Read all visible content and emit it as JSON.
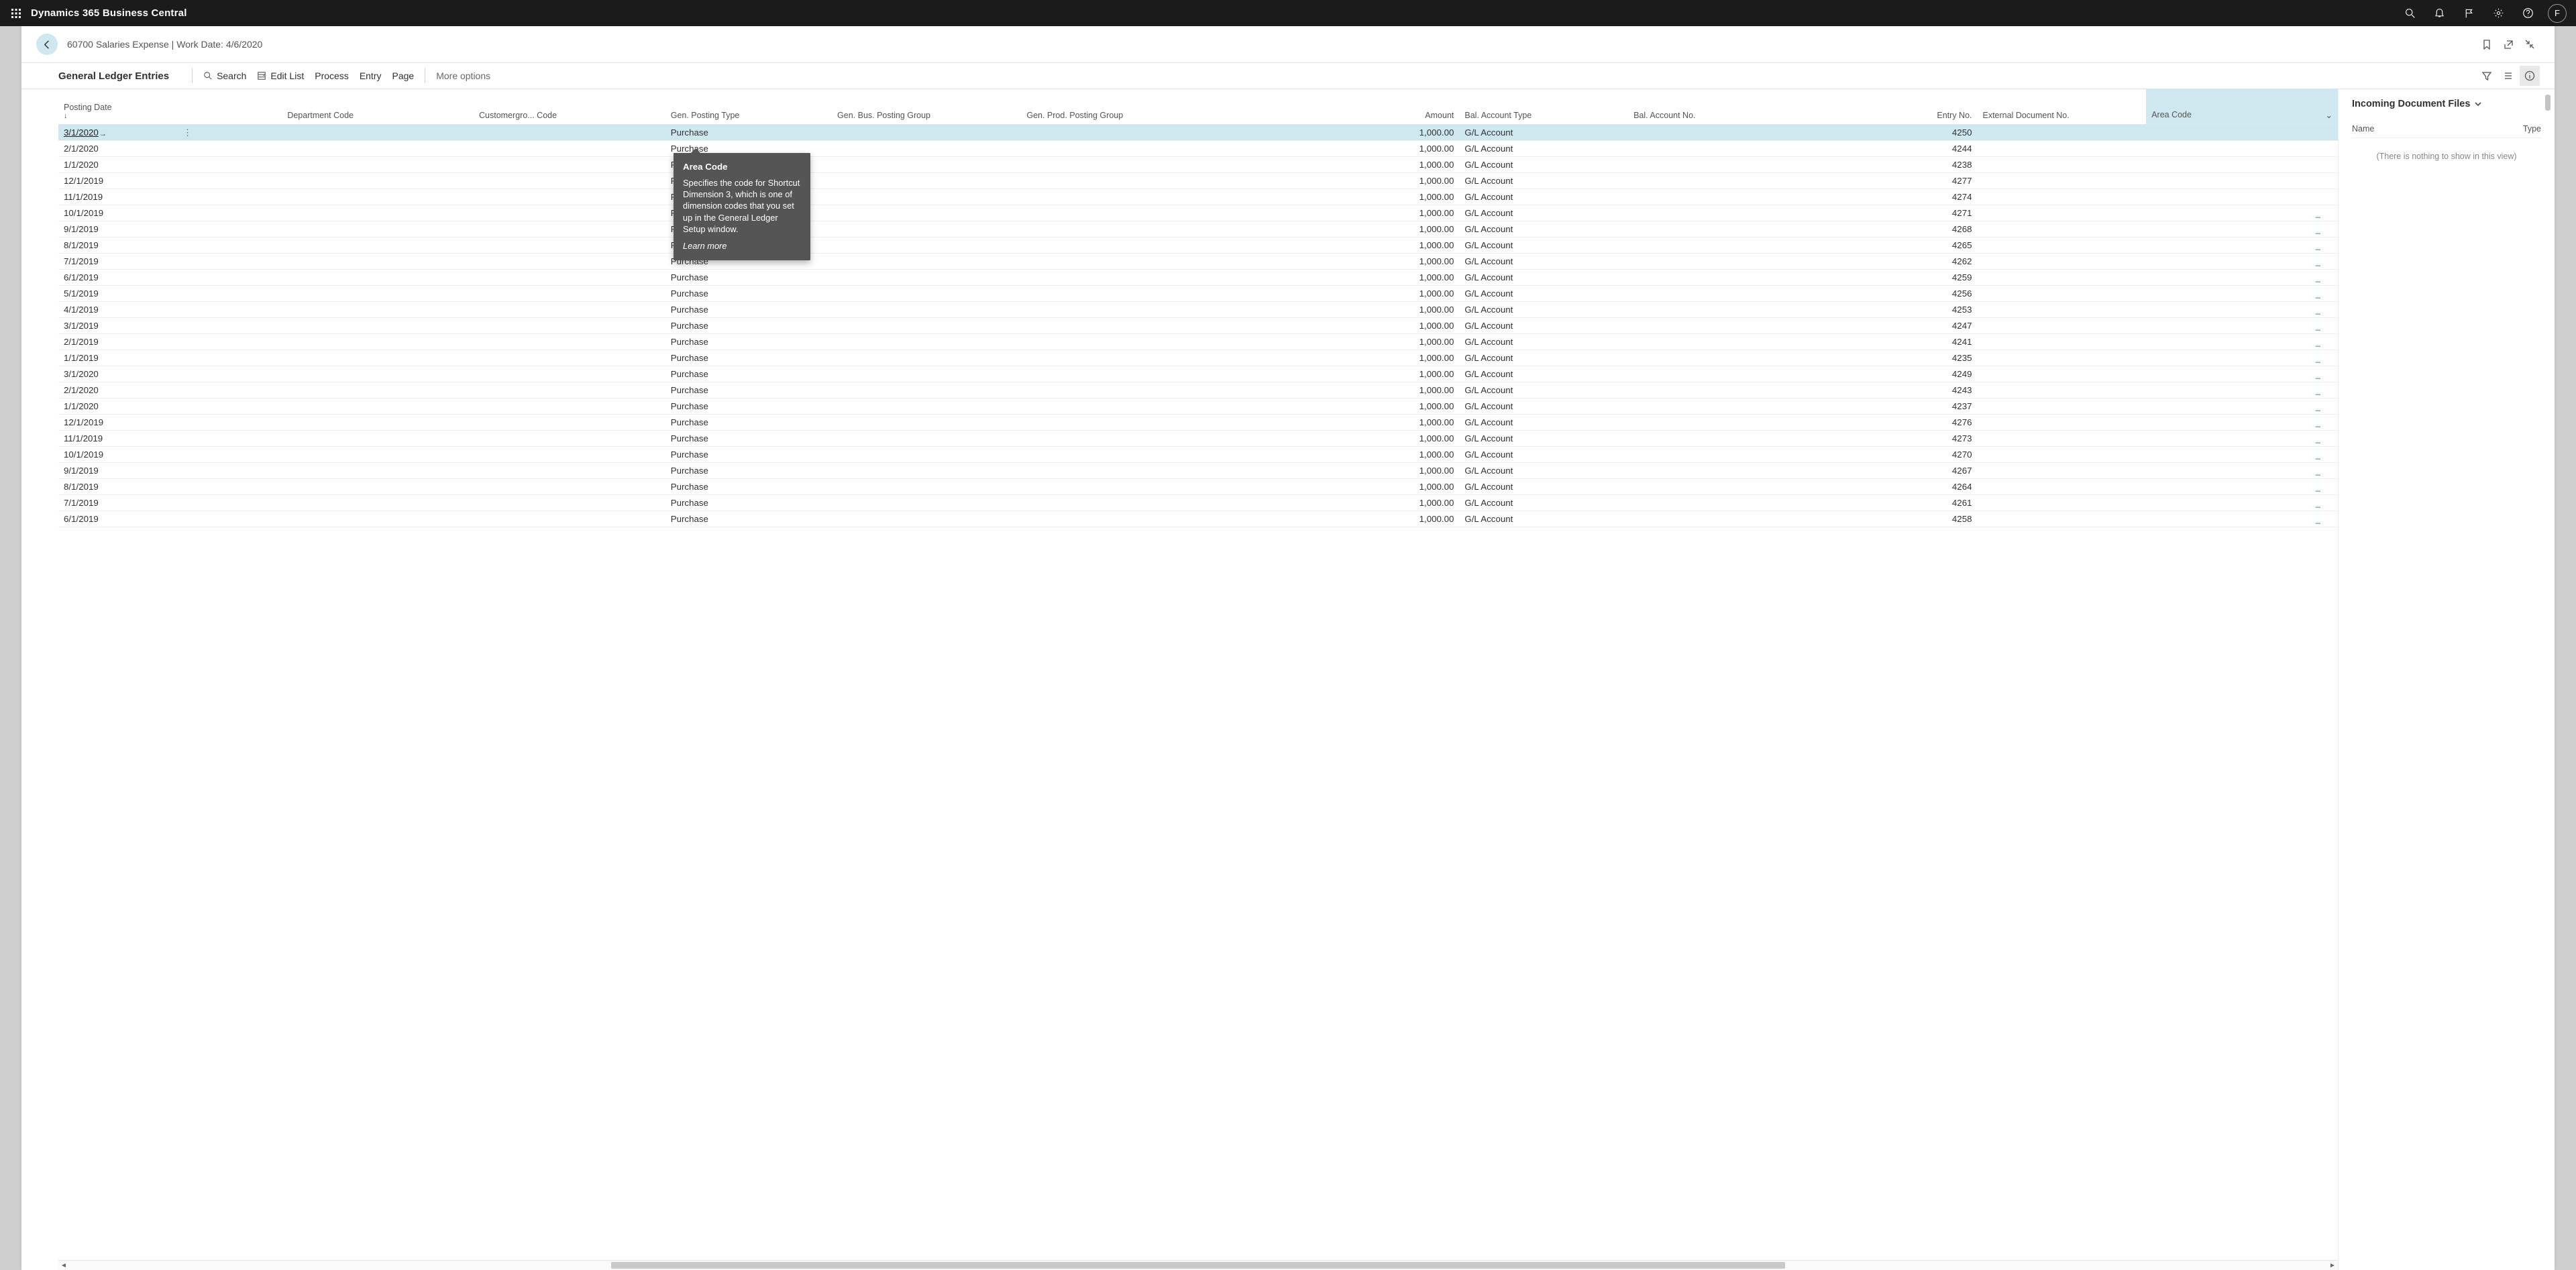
{
  "topbar": {
    "app_title": "Dynamics 365 Business Central",
    "avatar_initial": "F"
  },
  "page": {
    "breadcrumb": "60700 Salaries Expense | Work Date: 4/6/2020",
    "view_name": "General Ledger Entries"
  },
  "commands": {
    "search": "Search",
    "edit_list": "Edit List",
    "process": "Process",
    "entry": "Entry",
    "page": "Page",
    "more": "More options"
  },
  "columns": {
    "posting_date": "Posting Date",
    "department": "Department Code",
    "customer_group": "Customergro... Code",
    "gen_posting_type": "Gen. Posting Type",
    "gen_bus_group": "Gen. Bus. Posting Group",
    "gen_prod_group": "Gen. Prod. Posting Group",
    "amount": "Amount",
    "bal_account_type": "Bal. Account Type",
    "bal_account_no": "Bal. Account No.",
    "entry_no": "Entry No.",
    "ext_doc_no": "External Document No.",
    "area_code": "Area Code",
    "sort_indicator": "↓"
  },
  "rows": [
    {
      "date": "3/1/2020",
      "gpt": "Purchase",
      "amount": "1,000.00",
      "bat": "G/L Account",
      "entry": "4250",
      "area": ""
    },
    {
      "date": "2/1/2020",
      "gpt": "Purchase",
      "amount": "1,000.00",
      "bat": "G/L Account",
      "entry": "4244",
      "area": ""
    },
    {
      "date": "1/1/2020",
      "gpt": "Purchase",
      "amount": "1,000.00",
      "bat": "G/L Account",
      "entry": "4238",
      "area": ""
    },
    {
      "date": "12/1/2019",
      "gpt": "Purchase",
      "amount": "1,000.00",
      "bat": "G/L Account",
      "entry": "4277",
      "area": ""
    },
    {
      "date": "11/1/2019",
      "gpt": "Purchase",
      "amount": "1,000.00",
      "bat": "G/L Account",
      "entry": "4274",
      "area": ""
    },
    {
      "date": "10/1/2019",
      "gpt": "Purchase",
      "amount": "1,000.00",
      "bat": "G/L Account",
      "entry": "4271",
      "area": "_"
    },
    {
      "date": "9/1/2019",
      "gpt": "Purchase",
      "amount": "1,000.00",
      "bat": "G/L Account",
      "entry": "4268",
      "area": "_"
    },
    {
      "date": "8/1/2019",
      "gpt": "Purchase",
      "amount": "1,000.00",
      "bat": "G/L Account",
      "entry": "4265",
      "area": "_"
    },
    {
      "date": "7/1/2019",
      "gpt": "Purchase",
      "amount": "1,000.00",
      "bat": "G/L Account",
      "entry": "4262",
      "area": "_"
    },
    {
      "date": "6/1/2019",
      "gpt": "Purchase",
      "amount": "1,000.00",
      "bat": "G/L Account",
      "entry": "4259",
      "area": "_"
    },
    {
      "date": "5/1/2019",
      "gpt": "Purchase",
      "amount": "1,000.00",
      "bat": "G/L Account",
      "entry": "4256",
      "area": "_"
    },
    {
      "date": "4/1/2019",
      "gpt": "Purchase",
      "amount": "1,000.00",
      "bat": "G/L Account",
      "entry": "4253",
      "area": "_"
    },
    {
      "date": "3/1/2019",
      "gpt": "Purchase",
      "amount": "1,000.00",
      "bat": "G/L Account",
      "entry": "4247",
      "area": "_"
    },
    {
      "date": "2/1/2019",
      "gpt": "Purchase",
      "amount": "1,000.00",
      "bat": "G/L Account",
      "entry": "4241",
      "area": "_"
    },
    {
      "date": "1/1/2019",
      "gpt": "Purchase",
      "amount": "1,000.00",
      "bat": "G/L Account",
      "entry": "4235",
      "area": "_"
    },
    {
      "date": "3/1/2020",
      "gpt": "Purchase",
      "amount": "1,000.00",
      "bat": "G/L Account",
      "entry": "4249",
      "area": "_"
    },
    {
      "date": "2/1/2020",
      "gpt": "Purchase",
      "amount": "1,000.00",
      "bat": "G/L Account",
      "entry": "4243",
      "area": "_"
    },
    {
      "date": "1/1/2020",
      "gpt": "Purchase",
      "amount": "1,000.00",
      "bat": "G/L Account",
      "entry": "4237",
      "area": "_"
    },
    {
      "date": "12/1/2019",
      "gpt": "Purchase",
      "amount": "1,000.00",
      "bat": "G/L Account",
      "entry": "4276",
      "area": "_"
    },
    {
      "date": "11/1/2019",
      "gpt": "Purchase",
      "amount": "1,000.00",
      "bat": "G/L Account",
      "entry": "4273",
      "area": "_"
    },
    {
      "date": "10/1/2019",
      "gpt": "Purchase",
      "amount": "1,000.00",
      "bat": "G/L Account",
      "entry": "4270",
      "area": "_"
    },
    {
      "date": "9/1/2019",
      "gpt": "Purchase",
      "amount": "1,000.00",
      "bat": "G/L Account",
      "entry": "4267",
      "area": "_"
    },
    {
      "date": "8/1/2019",
      "gpt": "Purchase",
      "amount": "1,000.00",
      "bat": "G/L Account",
      "entry": "4264",
      "area": "_"
    },
    {
      "date": "7/1/2019",
      "gpt": "Purchase",
      "amount": "1,000.00",
      "bat": "G/L Account",
      "entry": "4261",
      "area": "_"
    },
    {
      "date": "6/1/2019",
      "gpt": "Purchase",
      "amount": "1,000.00",
      "bat": "G/L Account",
      "entry": "4258",
      "area": "_"
    }
  ],
  "tooltip": {
    "title": "Area Code",
    "body": "Specifies the code for Shortcut Dimension 3, which is one of dimension codes that you set up in the General Ledger Setup window.",
    "learn": "Learn more"
  },
  "factbox": {
    "title": "Incoming Document Files",
    "col_name": "Name",
    "col_type": "Type",
    "empty": "(There is nothing to show in this view)"
  }
}
